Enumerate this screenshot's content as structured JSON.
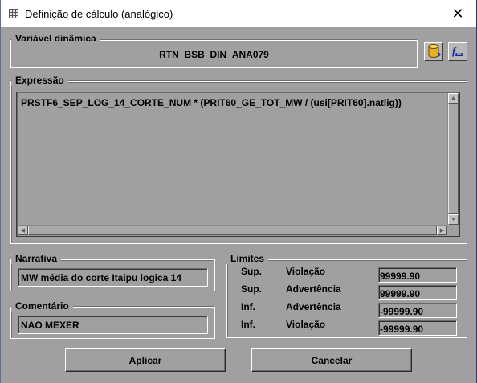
{
  "window": {
    "title": "Definição de cálculo (analógico)",
    "close_glyph": "✕",
    "icon": "app-grid-icon"
  },
  "variavel": {
    "label": "Variável dinâmica",
    "value": "RTN_BSB_DIN_ANA079",
    "db_icon": "database-icon",
    "func_icon": "function-icon",
    "func_label": "f..."
  },
  "expressao": {
    "label": "Expressão",
    "text": "PRSTF6_SEP_LOG_14_CORTE_NUM  * (PRIT60_GE_TOT_MW / (usi[PRIT60].natlig))"
  },
  "narrativa": {
    "label": "Narrativa",
    "value": "MW média do corte Itaipu logica 14"
  },
  "comentario": {
    "label": "Comentário",
    "value": "NAO MEXER"
  },
  "limites": {
    "label": "Limites",
    "rows": [
      {
        "kind": "Sup.",
        "type": "Violação",
        "value": "99999.90"
      },
      {
        "kind": "Sup.",
        "type": "Advertência",
        "value": "99999.90"
      },
      {
        "kind": "Inf.",
        "type": "Advertência",
        "value": "-99999.90"
      },
      {
        "kind": "Inf.",
        "type": "Violação",
        "value": "-99999.90"
      }
    ]
  },
  "buttons": {
    "apply": "Aplicar",
    "cancel": "Cancelar"
  },
  "colors": {
    "dialog_bg": "#a0a0a0",
    "titlebar_bg": "#ffffff",
    "func_accent": "#1a2a9a",
    "db_accent": "#e8b020"
  }
}
